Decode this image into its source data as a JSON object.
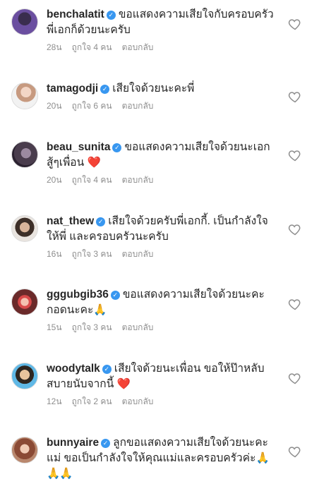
{
  "labels": {
    "reply": "ตอบกลับ"
  },
  "icons": {
    "verified": "verified-badge-icon",
    "like": "heart-outline-icon",
    "red_heart": "red-heart-emoji-icon",
    "pray": "praying-hands-emoji-icon"
  },
  "colors": {
    "verified": "#3897f0",
    "meta_text": "#8e8e8e",
    "heart_emoji": "#e0245e"
  },
  "comments": [
    {
      "username": "benchalatit",
      "text": "ขอแสดงความเสียใจกับครอบครัวพี่เอกก็ด้วยนะครับ",
      "emoji": "",
      "time": "28น",
      "likes": "ถูกใจ 4 คน"
    },
    {
      "username": "tamagodji",
      "text": "เสียใจด้วยนะคะพี่",
      "emoji": "",
      "time": "20น",
      "likes": "ถูกใจ 6 คน"
    },
    {
      "username": "beau_sunita",
      "text": "ขอแสดงความเสียใจด้วยนะเอก สู้ๆเพื่อน",
      "emoji": "❤️",
      "time": "20น",
      "likes": "ถูกใจ 4 คน"
    },
    {
      "username": "nat_thew",
      "text": "เสียใจด้วยครับพี่เอกกี้. เป็นกำลังใจให้พี่ และครอบครัวนะครับ",
      "emoji": "",
      "time": "16น",
      "likes": "ถูกใจ 3 คน"
    },
    {
      "username": "gggubgib36",
      "text": "ขอแสดงความเสียใจด้วยนะคะกอดนะคะ",
      "emoji": "🙏",
      "time": "15น",
      "likes": "ถูกใจ 3 คน"
    },
    {
      "username": "woodytalk",
      "text": "เสียใจด้วยนะเพื่อน ขอให้ป๊าหลับสบายนับจากนี้",
      "emoji": "❤️",
      "time": "12น",
      "likes": "ถูกใจ 2 คน"
    },
    {
      "username": "bunnyaire",
      "text": "ลูกขอแสดงความเสียใจด้วยนะคะแม่ ขอเป็นกำลังใจให้คุณแม่และครอบครัวค่ะ",
      "emoji": "🙏🙏🙏",
      "time": "",
      "likes": ""
    }
  ]
}
